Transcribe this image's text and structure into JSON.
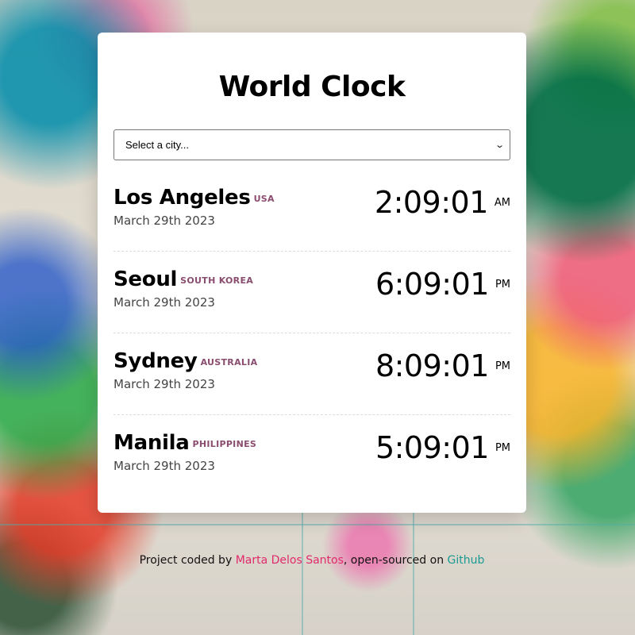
{
  "header": {
    "title": "World Clock"
  },
  "city_select": {
    "selected": "Select a city...",
    "icon": "chevron-down-icon"
  },
  "cities": [
    {
      "name": "Los Angeles",
      "country": "USA",
      "date": "March 29th 2023",
      "time": "2:09:01",
      "ampm": "AM"
    },
    {
      "name": "Seoul",
      "country": "SOUTH KOREA",
      "date": "March 29th 2023",
      "time": "6:09:01",
      "ampm": "PM"
    },
    {
      "name": "Sydney",
      "country": "AUSTRALIA",
      "date": "March 29th 2023",
      "time": "8:09:01",
      "ampm": "PM"
    },
    {
      "name": "Manila",
      "country": "PHILIPPINES",
      "date": "March 29th 2023",
      "time": "5:09:01",
      "ampm": "PM"
    }
  ],
  "footer": {
    "prefix": "Project coded by ",
    "author": "Marta Delos Santos",
    "middle": ", open-sourced on ",
    "github": "Github"
  },
  "colors": {
    "country_label": "#8a4d6f",
    "author_link": "#e02a6a",
    "github_link": "#1a9a92"
  }
}
